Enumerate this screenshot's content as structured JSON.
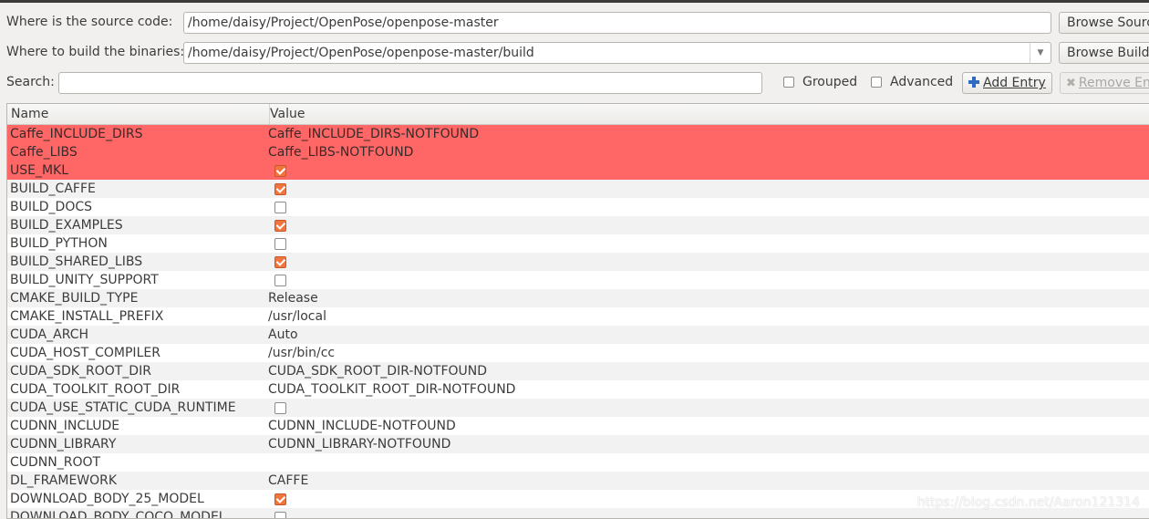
{
  "source": {
    "label": "Where is the source code:",
    "value": "/home/daisy/Project/OpenPose/openpose-master",
    "browse_label": "Browse Source..."
  },
  "build": {
    "label": "Where to build the binaries:",
    "value": "/home/daisy/Project/OpenPose/openpose-master/build",
    "browse_label": "Browse Build..."
  },
  "search": {
    "label": "Search:",
    "value": ""
  },
  "options": {
    "grouped_label": "Grouped",
    "grouped_checked": false,
    "advanced_label": "Advanced",
    "advanced_checked": false,
    "add_entry_label": "Add Entry",
    "remove_entry_label": "Remove Entry"
  },
  "table": {
    "headers": [
      "Name",
      "Value"
    ],
    "rows": [
      {
        "name": "Caffe_INCLUDE_DIRS",
        "value": "Caffe_INCLUDE_DIRS-NOTFOUND",
        "kind": "text",
        "status": "error"
      },
      {
        "name": "Caffe_LIBS",
        "value": "Caffe_LIBS-NOTFOUND",
        "kind": "text",
        "status": "error"
      },
      {
        "name": "USE_MKL",
        "checked": true,
        "kind": "bool",
        "status": "error"
      },
      {
        "name": "BUILD_CAFFE",
        "checked": true,
        "kind": "bool",
        "status": "normal"
      },
      {
        "name": "BUILD_DOCS",
        "checked": false,
        "kind": "bool",
        "status": "normal"
      },
      {
        "name": "BUILD_EXAMPLES",
        "checked": true,
        "kind": "bool",
        "status": "normal"
      },
      {
        "name": "BUILD_PYTHON",
        "checked": false,
        "kind": "bool",
        "status": "normal"
      },
      {
        "name": "BUILD_SHARED_LIBS",
        "checked": true,
        "kind": "bool",
        "status": "normal"
      },
      {
        "name": "BUILD_UNITY_SUPPORT",
        "checked": false,
        "kind": "bool",
        "status": "normal"
      },
      {
        "name": "CMAKE_BUILD_TYPE",
        "value": "Release",
        "kind": "text",
        "status": "normal"
      },
      {
        "name": "CMAKE_INSTALL_PREFIX",
        "value": "/usr/local",
        "kind": "text",
        "status": "normal"
      },
      {
        "name": "CUDA_ARCH",
        "value": "Auto",
        "kind": "text",
        "status": "normal"
      },
      {
        "name": "CUDA_HOST_COMPILER",
        "value": "/usr/bin/cc",
        "kind": "text",
        "status": "normal"
      },
      {
        "name": "CUDA_SDK_ROOT_DIR",
        "value": "CUDA_SDK_ROOT_DIR-NOTFOUND",
        "kind": "text",
        "status": "normal"
      },
      {
        "name": "CUDA_TOOLKIT_ROOT_DIR",
        "value": "CUDA_TOOLKIT_ROOT_DIR-NOTFOUND",
        "kind": "text",
        "status": "normal"
      },
      {
        "name": "CUDA_USE_STATIC_CUDA_RUNTIME",
        "checked": false,
        "kind": "bool",
        "status": "normal"
      },
      {
        "name": "CUDNN_INCLUDE",
        "value": "CUDNN_INCLUDE-NOTFOUND",
        "kind": "text",
        "status": "normal"
      },
      {
        "name": "CUDNN_LIBRARY",
        "value": "CUDNN_LIBRARY-NOTFOUND",
        "kind": "text",
        "status": "normal"
      },
      {
        "name": "CUDNN_ROOT",
        "value": "",
        "kind": "text",
        "status": "normal"
      },
      {
        "name": "DL_FRAMEWORK",
        "value": "CAFFE",
        "kind": "text",
        "status": "normal"
      },
      {
        "name": "DOWNLOAD_BODY_25_MODEL",
        "checked": true,
        "kind": "bool",
        "status": "normal"
      },
      {
        "name": "DOWNLOAD_BODY_COCO_MODEL",
        "checked": false,
        "kind": "bool",
        "status": "normal"
      }
    ]
  },
  "watermark": "https://blog.csdn.net/Aaron121314",
  "colors": {
    "error_row": "#ff6666",
    "checkbox_checked": "#f0763e"
  }
}
